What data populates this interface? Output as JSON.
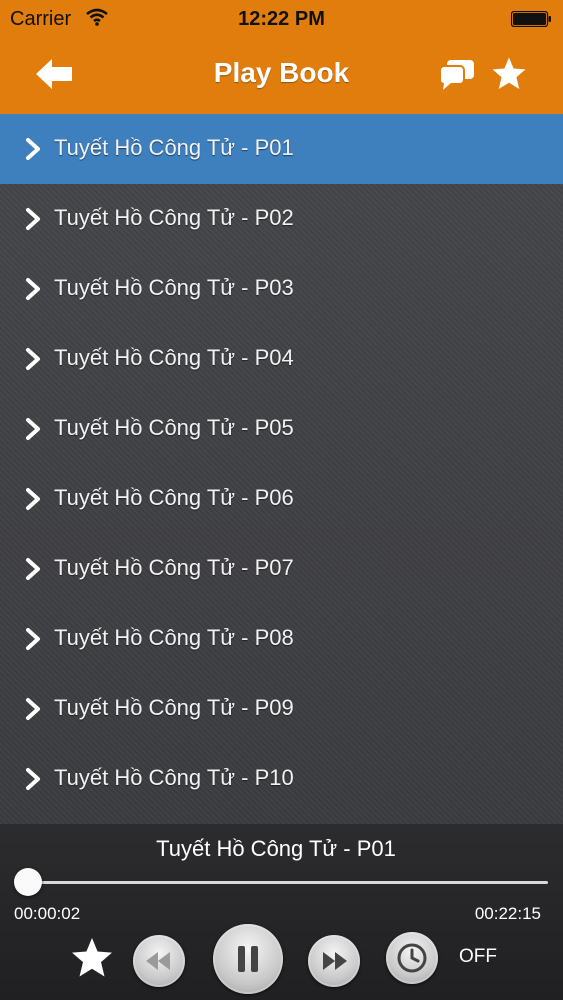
{
  "status_bar": {
    "carrier": "Carrier",
    "time": "12:22 PM"
  },
  "nav": {
    "title": "Play Book",
    "back_icon": "arrow-left-icon",
    "chat_icon": "chat-bubbles-icon",
    "favorite_icon": "star-icon"
  },
  "list": {
    "items": [
      {
        "label": "Tuyết Hồ Công Tử - P01",
        "selected": true
      },
      {
        "label": "Tuyết Hồ Công Tử - P02"
      },
      {
        "label": "Tuyết Hồ Công Tử - P03"
      },
      {
        "label": "Tuyết Hồ Công Tử - P04"
      },
      {
        "label": "Tuyết Hồ Công Tử - P05"
      },
      {
        "label": "Tuyết Hồ Công Tử - P06"
      },
      {
        "label": "Tuyết Hồ Công Tử - P07"
      },
      {
        "label": "Tuyết Hồ Công Tử - P08"
      },
      {
        "label": "Tuyết Hồ Công Tử - P09"
      },
      {
        "label": "Tuyết Hồ Công Tử - P10"
      }
    ]
  },
  "player": {
    "now_playing": "Tuyết Hồ Công Tử - P01",
    "elapsed": "00:00:02",
    "total": "00:22:15",
    "progress": 0.0015,
    "timer_status": "OFF"
  },
  "colors": {
    "accent": "#e07d0c",
    "selected_row": "#3e7fbd",
    "list_background": "#3f4044",
    "player_background": "#252527"
  }
}
